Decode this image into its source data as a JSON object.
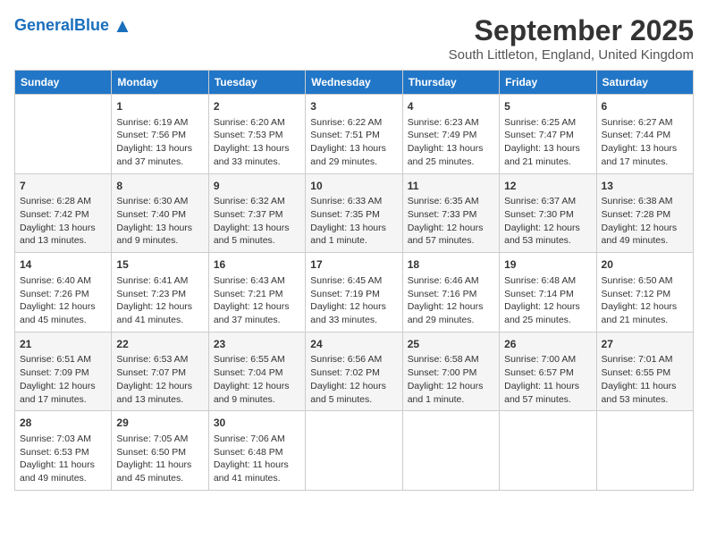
{
  "header": {
    "logo_general": "General",
    "logo_blue": "Blue",
    "month": "September 2025",
    "location": "South Littleton, England, United Kingdom"
  },
  "days_of_week": [
    "Sunday",
    "Monday",
    "Tuesday",
    "Wednesday",
    "Thursday",
    "Friday",
    "Saturday"
  ],
  "weeks": [
    [
      {
        "day": "",
        "content": ""
      },
      {
        "day": "1",
        "content": "Sunrise: 6:19 AM\nSunset: 7:56 PM\nDaylight: 13 hours\nand 37 minutes."
      },
      {
        "day": "2",
        "content": "Sunrise: 6:20 AM\nSunset: 7:53 PM\nDaylight: 13 hours\nand 33 minutes."
      },
      {
        "day": "3",
        "content": "Sunrise: 6:22 AM\nSunset: 7:51 PM\nDaylight: 13 hours\nand 29 minutes."
      },
      {
        "day": "4",
        "content": "Sunrise: 6:23 AM\nSunset: 7:49 PM\nDaylight: 13 hours\nand 25 minutes."
      },
      {
        "day": "5",
        "content": "Sunrise: 6:25 AM\nSunset: 7:47 PM\nDaylight: 13 hours\nand 21 minutes."
      },
      {
        "day": "6",
        "content": "Sunrise: 6:27 AM\nSunset: 7:44 PM\nDaylight: 13 hours\nand 17 minutes."
      }
    ],
    [
      {
        "day": "7",
        "content": "Sunrise: 6:28 AM\nSunset: 7:42 PM\nDaylight: 13 hours\nand 13 minutes."
      },
      {
        "day": "8",
        "content": "Sunrise: 6:30 AM\nSunset: 7:40 PM\nDaylight: 13 hours\nand 9 minutes."
      },
      {
        "day": "9",
        "content": "Sunrise: 6:32 AM\nSunset: 7:37 PM\nDaylight: 13 hours\nand 5 minutes."
      },
      {
        "day": "10",
        "content": "Sunrise: 6:33 AM\nSunset: 7:35 PM\nDaylight: 13 hours\nand 1 minute."
      },
      {
        "day": "11",
        "content": "Sunrise: 6:35 AM\nSunset: 7:33 PM\nDaylight: 12 hours\nand 57 minutes."
      },
      {
        "day": "12",
        "content": "Sunrise: 6:37 AM\nSunset: 7:30 PM\nDaylight: 12 hours\nand 53 minutes."
      },
      {
        "day": "13",
        "content": "Sunrise: 6:38 AM\nSunset: 7:28 PM\nDaylight: 12 hours\nand 49 minutes."
      }
    ],
    [
      {
        "day": "14",
        "content": "Sunrise: 6:40 AM\nSunset: 7:26 PM\nDaylight: 12 hours\nand 45 minutes."
      },
      {
        "day": "15",
        "content": "Sunrise: 6:41 AM\nSunset: 7:23 PM\nDaylight: 12 hours\nand 41 minutes."
      },
      {
        "day": "16",
        "content": "Sunrise: 6:43 AM\nSunset: 7:21 PM\nDaylight: 12 hours\nand 37 minutes."
      },
      {
        "day": "17",
        "content": "Sunrise: 6:45 AM\nSunset: 7:19 PM\nDaylight: 12 hours\nand 33 minutes."
      },
      {
        "day": "18",
        "content": "Sunrise: 6:46 AM\nSunset: 7:16 PM\nDaylight: 12 hours\nand 29 minutes."
      },
      {
        "day": "19",
        "content": "Sunrise: 6:48 AM\nSunset: 7:14 PM\nDaylight: 12 hours\nand 25 minutes."
      },
      {
        "day": "20",
        "content": "Sunrise: 6:50 AM\nSunset: 7:12 PM\nDaylight: 12 hours\nand 21 minutes."
      }
    ],
    [
      {
        "day": "21",
        "content": "Sunrise: 6:51 AM\nSunset: 7:09 PM\nDaylight: 12 hours\nand 17 minutes."
      },
      {
        "day": "22",
        "content": "Sunrise: 6:53 AM\nSunset: 7:07 PM\nDaylight: 12 hours\nand 13 minutes."
      },
      {
        "day": "23",
        "content": "Sunrise: 6:55 AM\nSunset: 7:04 PM\nDaylight: 12 hours\nand 9 minutes."
      },
      {
        "day": "24",
        "content": "Sunrise: 6:56 AM\nSunset: 7:02 PM\nDaylight: 12 hours\nand 5 minutes."
      },
      {
        "day": "25",
        "content": "Sunrise: 6:58 AM\nSunset: 7:00 PM\nDaylight: 12 hours\nand 1 minute."
      },
      {
        "day": "26",
        "content": "Sunrise: 7:00 AM\nSunset: 6:57 PM\nDaylight: 11 hours\nand 57 minutes."
      },
      {
        "day": "27",
        "content": "Sunrise: 7:01 AM\nSunset: 6:55 PM\nDaylight: 11 hours\nand 53 minutes."
      }
    ],
    [
      {
        "day": "28",
        "content": "Sunrise: 7:03 AM\nSunset: 6:53 PM\nDaylight: 11 hours\nand 49 minutes."
      },
      {
        "day": "29",
        "content": "Sunrise: 7:05 AM\nSunset: 6:50 PM\nDaylight: 11 hours\nand 45 minutes."
      },
      {
        "day": "30",
        "content": "Sunrise: 7:06 AM\nSunset: 6:48 PM\nDaylight: 11 hours\nand 41 minutes."
      },
      {
        "day": "",
        "content": ""
      },
      {
        "day": "",
        "content": ""
      },
      {
        "day": "",
        "content": ""
      },
      {
        "day": "",
        "content": ""
      }
    ]
  ]
}
